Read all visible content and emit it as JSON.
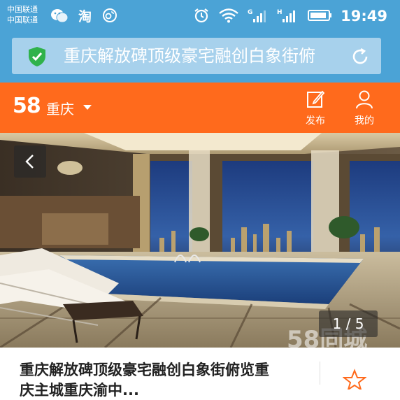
{
  "status_bar": {
    "carrier_1": "中国联通",
    "carrier_2": "中国联通",
    "taobao_label": "淘",
    "time": "19:49",
    "signal_1_tag": "G",
    "signal_2_tag": "H",
    "icons": [
      "wechat-icon",
      "taobao-icon",
      "weibo-icon",
      "alarm-icon",
      "wifi-icon",
      "signal-icon",
      "signal-icon",
      "battery-icon"
    ]
  },
  "url_bar": {
    "title": "重庆解放碑顶级豪宅融创白象街俯",
    "icons": [
      "shield-check-icon",
      "refresh-icon"
    ]
  },
  "header": {
    "logo": "58",
    "city": "重庆",
    "publish_label": "发布",
    "mine_label": "我的",
    "icons": [
      "chevron-down-icon",
      "edit-icon",
      "user-icon"
    ]
  },
  "gallery": {
    "current": 1,
    "total": 5,
    "pager": "1 / 5",
    "watermark": "58同城",
    "icons": [
      "chevron-left-icon"
    ]
  },
  "listing": {
    "title_line_1": "重庆解放碑顶级豪宅融创白象街俯览重",
    "title_line_2": "庆主城重庆渝中..."
  },
  "colors": {
    "status_blue": "#4ba3d6",
    "brand_orange": "#ff6a1c",
    "secure_green": "#2fb24b"
  }
}
